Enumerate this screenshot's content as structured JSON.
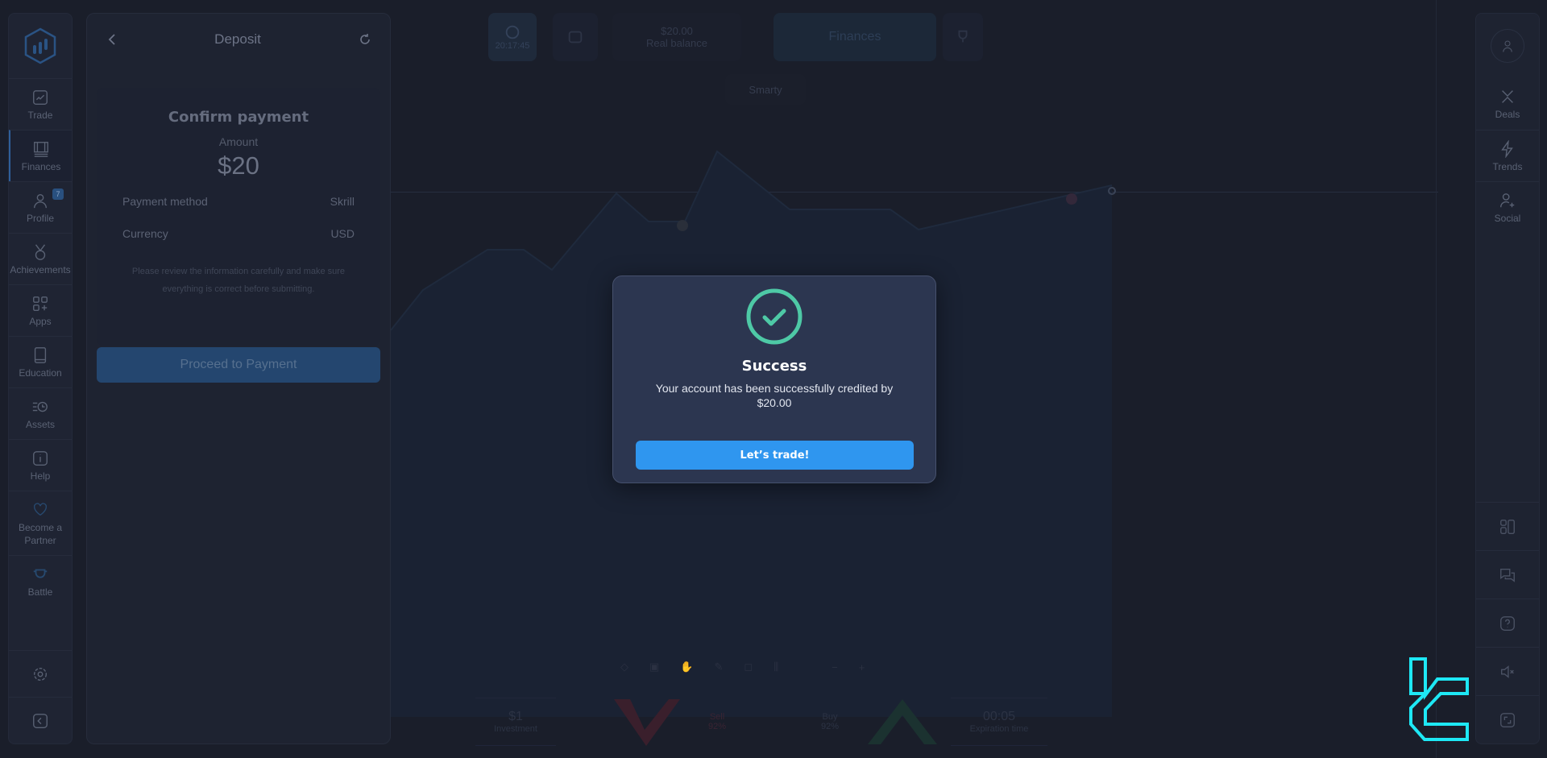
{
  "left_sidebar": {
    "logo": "bar-chart-hexagon-logo",
    "items": [
      {
        "label": "Trade",
        "icon": "trade-chart-icon"
      },
      {
        "label": "Finances",
        "icon": "finances-icon",
        "active": true
      },
      {
        "label": "Profile",
        "icon": "profile-icon",
        "badge": "7"
      },
      {
        "label": "Achievements",
        "icon": "medal-icon"
      },
      {
        "label": "Apps",
        "icon": "apps-grid-icon"
      },
      {
        "label": "Education",
        "icon": "book-icon"
      },
      {
        "label": "Assets",
        "icon": "assets-clock-icon"
      },
      {
        "label": "Help",
        "icon": "info-icon"
      },
      {
        "label": "Become a Partner",
        "icon": "heart-icon"
      },
      {
        "label": "Battle",
        "icon": "battle-trophy-icon"
      }
    ],
    "bottom": [
      {
        "icon": "gear-icon"
      },
      {
        "icon": "collapse-icon"
      }
    ]
  },
  "deposit_panel": {
    "title": "Deposit",
    "card_title": "Confirm payment",
    "amount_label": "Amount",
    "amount": "$20",
    "rows": [
      {
        "label": "Payment method",
        "value": "Skrill"
      },
      {
        "label": "Currency",
        "value": "USD"
      }
    ],
    "note": "Please review the information carefully and make sure everything is correct before submitting.",
    "proceed_label": "Proceed to Payment"
  },
  "top_bar": {
    "timer": "20:17:45",
    "balance_value": "$20.00",
    "balance_label": "Real balance",
    "finances_label": "Finances",
    "strategy_label": "Smarty"
  },
  "bottom_bar": {
    "amount_value": "$1",
    "amount_label": "Investment",
    "sell_label": "Sell",
    "sell_percent": "92%",
    "buy_label": "Buy",
    "buy_percent": "92%",
    "time_value": "00:05",
    "time_label": "Expiration time",
    "zoom_out": "−",
    "zoom_in": "+"
  },
  "right_sidebar": {
    "items": [
      {
        "label": "Deals",
        "icon": "deals-icon"
      },
      {
        "label": "Trends",
        "icon": "lightning-icon"
      },
      {
        "label": "Social",
        "icon": "add-user-icon"
      }
    ],
    "bottom": [
      {
        "icon": "layout-icon"
      },
      {
        "icon": "chat-icon"
      },
      {
        "icon": "question-icon"
      },
      {
        "icon": "mute-icon"
      },
      {
        "icon": "fullscreen-icon"
      }
    ]
  },
  "modal": {
    "title": "Success",
    "message": "Your account has been successfully credited by $20.00",
    "button_label": "Let’s trade!",
    "accent": "#4ec9a6",
    "button_color": "#2f96ef"
  },
  "colors": {
    "background": "#1a1e2a",
    "panel": "#1e2331",
    "modal_bg": "#2c3650",
    "watermark": "#1ee8f5"
  }
}
